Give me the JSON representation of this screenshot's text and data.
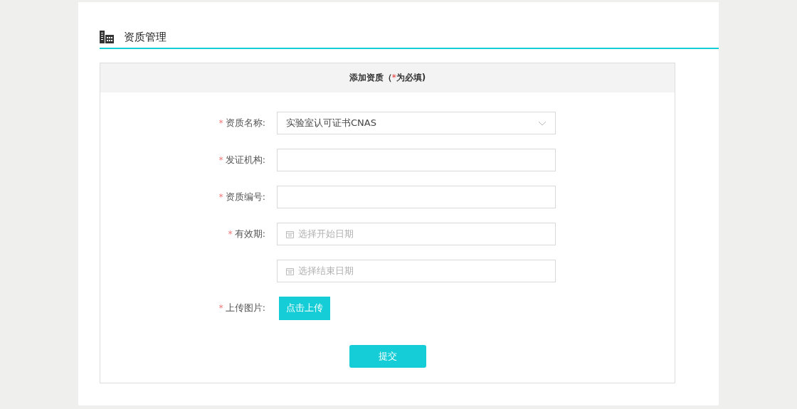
{
  "page_header": {
    "title": "资质管理"
  },
  "form": {
    "title": {
      "before": "添加资质（",
      "mark": "*",
      "after": "为必填)"
    },
    "fields": [
      {
        "kind": "select",
        "mark": "*",
        "label": "资质名称:",
        "value": "实验室认可证书CNAS"
      },
      {
        "kind": "text",
        "mark": "*",
        "label": "发证机构:"
      },
      {
        "kind": "text",
        "mark": "*",
        "label": "资质编号:"
      },
      {
        "kind": "date",
        "mark": "*",
        "label": "有效期:",
        "placeholder": "选择开始日期"
      },
      {
        "kind": "date",
        "placeholder": "选择结束日期"
      },
      {
        "kind": "upload",
        "mark": "*",
        "label": "上传图片:",
        "button": "点击上传"
      }
    ],
    "submit": "提交"
  }
}
